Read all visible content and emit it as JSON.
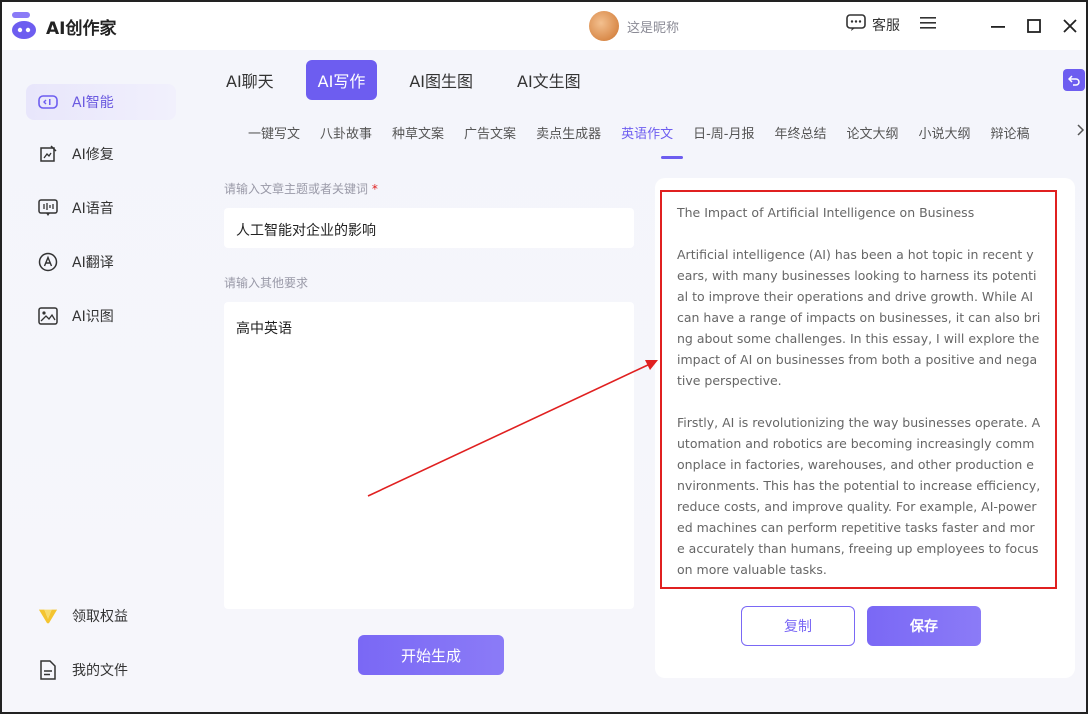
{
  "app": {
    "title": "AI创作家",
    "nickname": "这是昵称",
    "service_label": "客服"
  },
  "colors": {
    "accent": "#6d5df0",
    "highlight": "#e02020"
  },
  "sidebar": {
    "items": [
      {
        "label": "AI智能",
        "icon": "ai-chat-icon"
      },
      {
        "label": "AI修复",
        "icon": "image-repair-icon"
      },
      {
        "label": "AI语音",
        "icon": "voice-icon"
      },
      {
        "label": "AI翻译",
        "icon": "translate-icon"
      },
      {
        "label": "AI识图",
        "icon": "image-icon"
      }
    ],
    "bottom": [
      {
        "label": "领取权益",
        "icon": "vip-icon"
      },
      {
        "label": "我的文件",
        "icon": "file-icon"
      }
    ]
  },
  "main_tabs": [
    "AI聊天",
    "AI写作",
    "AI图生图",
    "AI文生图"
  ],
  "sub_tabs": [
    "一键写文",
    "八卦故事",
    "种草文案",
    "广告文案",
    "卖点生成器",
    "英语作文",
    "日-周-月报",
    "年终总结",
    "论文大纲",
    "小说大纲",
    "辩论稿"
  ],
  "form": {
    "topic_label": "请输入文章主题或者关键词",
    "required_mark": "*",
    "topic_value": "人工智能对企业的影响",
    "other_label": "请输入其他要求",
    "other_value": "高中英语",
    "generate_label": "开始生成"
  },
  "result": {
    "paragraphs": [
      "The Impact of Artificial Intelligence on Business",
      "Artificial intelligence (AI) has been a hot topic in recent years, with many businesses looking to harness its potential to improve their operations and drive growth. While AI can have a range of impacts on businesses, it can also bring about some challenges. In this essay, I will explore the impact of AI on businesses from both a positive and negative perspective.",
      "Firstly, AI is revolutionizing the way businesses operate. Automation and robotics are becoming increasingly commonplace in factories, warehouses, and other production environments. This has the potential to increase efficiency, reduce costs, and improve quality. For example, AI-powered machines can perform repetitive tasks faster and more accurately than humans, freeing up employees to focus on more valuable tasks."
    ],
    "copy_label": "复制",
    "save_label": "保存"
  }
}
